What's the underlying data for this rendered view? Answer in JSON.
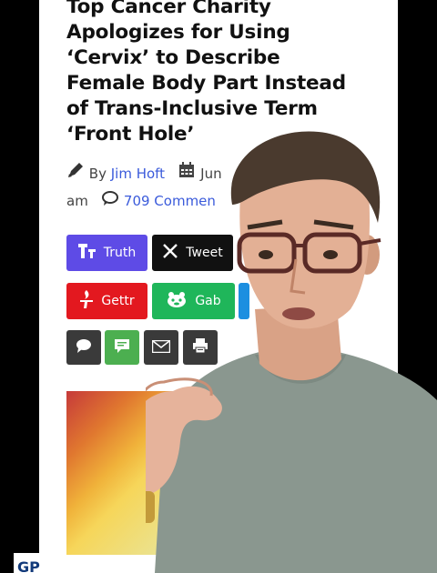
{
  "headline": {
    "lines": [
      "Top Cancer Charity",
      "Apologizes for Using",
      "‘Cervix’ to Describe",
      "Female Body Part Instead",
      "of Trans-Inclusive Term",
      "‘Front Hole’"
    ]
  },
  "byline": {
    "by": "By",
    "author": "Jim Hoft",
    "date_partial": "Jun",
    "time_suffix": "am",
    "comments": "709 Commen"
  },
  "share": {
    "truth": "Truth",
    "tweet": "Tweet",
    "gettr": "Gettr",
    "gab": "Gab"
  },
  "brand": {
    "logo_text": "GP"
  },
  "colors": {
    "truth": "#5e4be6",
    "tweet": "#111111",
    "gettr": "#e3181f",
    "gab": "#1fb65a",
    "chat": "#3a3a3a",
    "sms": "#4caf50",
    "email": "#3a3a3a",
    "print": "#3a3a3a",
    "link": "#3b5bdb"
  },
  "icons": [
    "pencil-icon",
    "calendar-icon",
    "comment-icon",
    "truth-social-icon",
    "x-icon",
    "gettr-icon",
    "gab-icon",
    "chat-icon",
    "sms-icon",
    "email-icon",
    "print-icon"
  ]
}
